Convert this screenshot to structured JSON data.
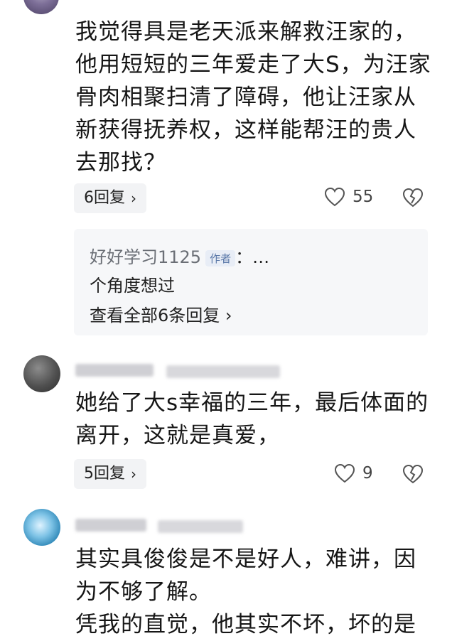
{
  "comments": [
    {
      "text": "我觉得具是老天派来解救汪家的，\n他用短短的三年爱走了大S，为汪家\n骨肉相聚扫清了障碍，他让汪家从\n新获得抚养权，这样能帮汪的贵人\n去那找？",
      "replies_label": "6回复",
      "likes": "55"
    },
    {
      "text": "她给了大s幸福的三年，最后体面的\n离开，这就是真爱，",
      "replies_label": "5回复",
      "likes": "9"
    },
    {
      "text": "其实具俊俊是不是好人，难讲，因\n为不够了解。\n凭我的直觉，他其实不坏，坏的是"
    }
  ],
  "sub_reply": {
    "author": "好好学习1125",
    "badge": "作者",
    "suffix": "：…",
    "text": "个角度想过",
    "view_all": "查看全部6条回复"
  },
  "icons": {
    "like": "heart-outline-icon",
    "dislike": "broken-heart-icon",
    "chevron": "chevron-right-icon"
  }
}
